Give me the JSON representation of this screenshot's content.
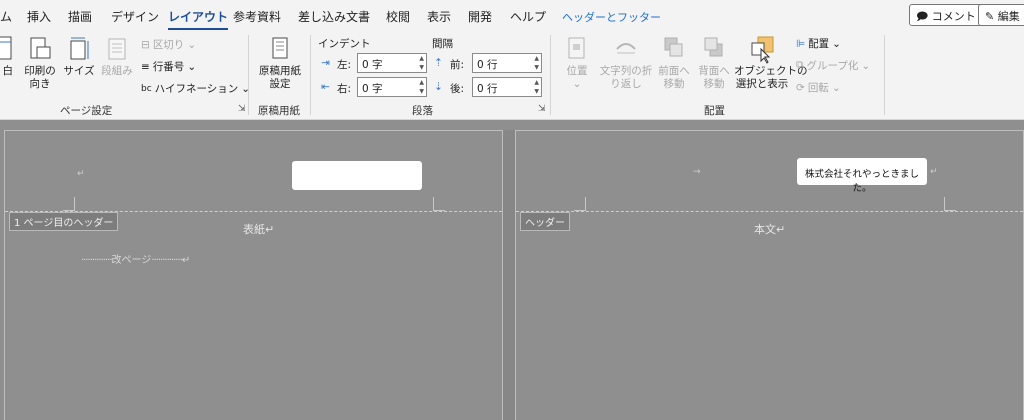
{
  "tabs": [
    "ム",
    "挿入",
    "描画",
    "デザイン",
    "レイアウト",
    "参考資料",
    "差し込み文書",
    "校閲",
    "表示",
    "開発",
    "ヘルプ",
    "ヘッダーとフッター"
  ],
  "top_buttons": {
    "comment": "コメント",
    "edit": "編集"
  },
  "page_setup": {
    "margins": "白",
    "orientation": [
      "印刷の",
      "向き"
    ],
    "size": "サイズ",
    "columns": "段組み",
    "breaks": "区切り",
    "line_numbers": "行番号",
    "hyphenation": "ハイフネーション",
    "group": "ページ設定"
  },
  "manuscript": {
    "button": [
      "原稿用紙",
      "設定"
    ],
    "group": "原稿用紙"
  },
  "paragraph": {
    "indent_header": "インデント",
    "spacing_header": "間隔",
    "left_label": "左:",
    "left_value": "0 字",
    "right_label": "右:",
    "right_value": "0 字",
    "before_label": "前:",
    "before_value": "0 行",
    "after_label": "後:",
    "after_value": "0 行",
    "group": "段落"
  },
  "arrange": {
    "position": "位置",
    "wrap": [
      "文字列の折",
      "り返し"
    ],
    "bring_forward": [
      "前面へ",
      "移動"
    ],
    "send_backward": [
      "背面へ",
      "移動"
    ],
    "selection_pane": [
      "オブジェクトの",
      "選択と表示"
    ],
    "align": "配置",
    "group_btn": "グループ化",
    "rotate": "回転",
    "group": "配置"
  },
  "document": {
    "page1_header_tag": "1 ページ目のヘッダー",
    "page1_body": "表紙↵",
    "page_break": "改ページ",
    "page2_header_tag": "ヘッダー",
    "page2_header_text": "株式会社それやっときました。",
    "page2_body": "本文↵",
    "para_mark": "↵",
    "arrow_mark": "→"
  },
  "colors": {
    "active_tab": "#1e4e9a",
    "context_tab": "#1e6fd0",
    "doc_bg": "#8f8f8f",
    "ribbon_bg": "#f3f3f3"
  }
}
